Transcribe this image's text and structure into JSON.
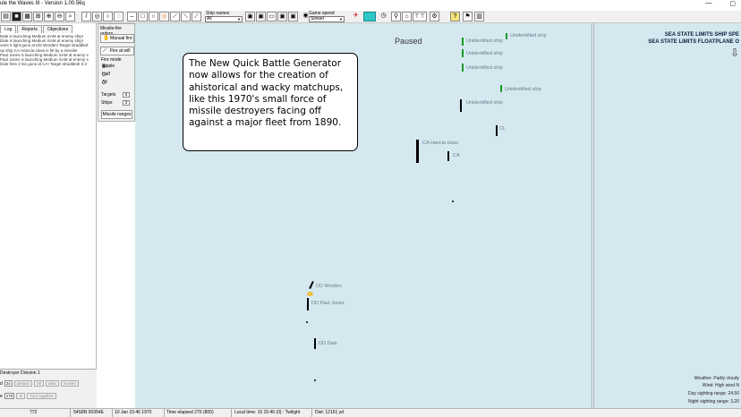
{
  "window": {
    "title": "ule the Waves III - Version 1.00.56q",
    "minimize": "—",
    "close_icon": "▢"
  },
  "toolbar": {
    "ship_names_label": "Ship names",
    "ship_names_value": "All",
    "game_speed_label": "Game speed",
    "game_speed_value": "Slower"
  },
  "left_panel": {
    "tabs": [
      "Log",
      "Reports",
      "Objectives"
    ],
    "log_lines": [
      "Dale is launching Medium SAM at enemy ship!",
      "Dale is launching Medium SAM at enemy ship!",
      "ones 5 light guns at DD Worden! Target straddled",
      "op ship CA Hamcia-class is hit by a missile!",
      "Paul Jones is launching Medium SAM at enemy s",
      "Paul Jones is launching Medium SAM at enemy s",
      "Dale fires 2 5in guns at CA! Target straddled! 3.3"
    ],
    "division": {
      "name": "Destroyer Division 1",
      "speed_value": "24",
      "buttons": [
        "Detach",
        "30",
        "Max",
        "Screen"
      ],
      "course_value": "170",
      "turn_label": "Turn together"
    }
  },
  "orders": {
    "header": "Missile-fire orders",
    "manual_fire": "Manual fire",
    "fire_at_will": "Fire at will",
    "fire_mode_label": "Fire mode",
    "modes": [
      "Ripple",
      "Half",
      "All"
    ],
    "targets_label": "Targets",
    "targets_value": "6",
    "ships_label": "Ships",
    "ships_value": "3",
    "missile_ranges": "Missile ranges"
  },
  "map": {
    "paused": "Paused",
    "overlay_text": [
      "The New Quick Battle Generator",
      "now allows for the creation of",
      "ahistorical and wacky matchups,",
      "like this 1970's small force of",
      "missile destroyers facing off",
      "against a major fleet from 1890."
    ],
    "ship_labels": {
      "unidentified1": "Unidentified ship",
      "unidentified2": "Unidentified ship",
      "unidentified3": "Unidentified ship",
      "unidentified4": "Unidentified ship",
      "unidentified5": "Unidentified ship",
      "unidentified6": "Unidentified ship",
      "cl": "CL",
      "ca_hancia": "CA Hancia class",
      "ca": "CA",
      "dd_worden": "DD Worden",
      "dd_paul_jones": "DD Paul Jones",
      "dd_dale": "DD Dale"
    },
    "sea_state_ship": "SEA STATE LIMITS SHIP SPE",
    "sea_state_floatplane": "SEA STATE LIMITS FLOATPLANE O",
    "weather": "Weather: Partly cloudy",
    "wind": "Wind: High wind  N",
    "day_range": "Day sighting range: 24,50",
    "night_range": "Night sighting range: 3,20"
  },
  "status_bar": {
    "cell1": "772",
    "coords": "54S8N 00354E",
    "date": "10 Jan 15:46 1970",
    "elapsed": "Time elapsed 270 (800)",
    "local_time": "Local time: 10 15:46 (0) : Twilight",
    "dist": "Dist: 12161 yd"
  },
  "colors": {
    "sea": "#d5e8f0",
    "ship_label": "#6a7a86",
    "unidentified_marker": "#1a9a2a",
    "sea_state_text": "#0c1e3a"
  }
}
